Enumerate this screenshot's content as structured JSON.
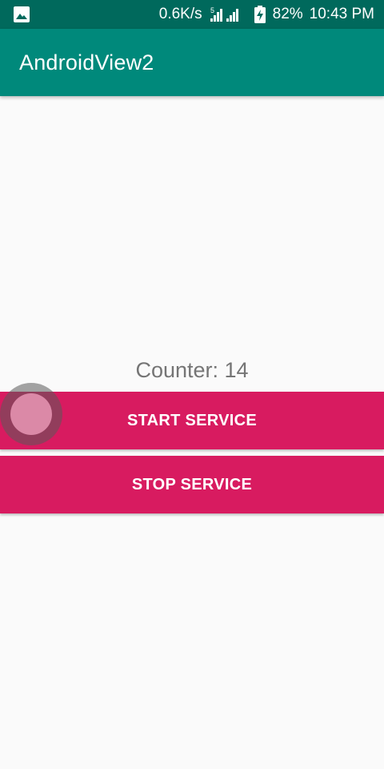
{
  "status_bar": {
    "net_speed": "0.6K/s",
    "network_type": "5",
    "battery": "82%",
    "time": "10:43 PM",
    "icons": [
      "gallery-icon",
      "signal-icon",
      "battery-charging-icon"
    ]
  },
  "app_bar": {
    "title": "AndroidView2"
  },
  "main": {
    "counter_text": "Counter: 14",
    "start_label": "START SERVICE",
    "stop_label": "STOP SERVICE"
  },
  "colors": {
    "status_bar": "#00695c",
    "app_bar": "#00897b",
    "accent": "#d81b60",
    "background": "#fafafa",
    "counter_text": "#757575"
  }
}
